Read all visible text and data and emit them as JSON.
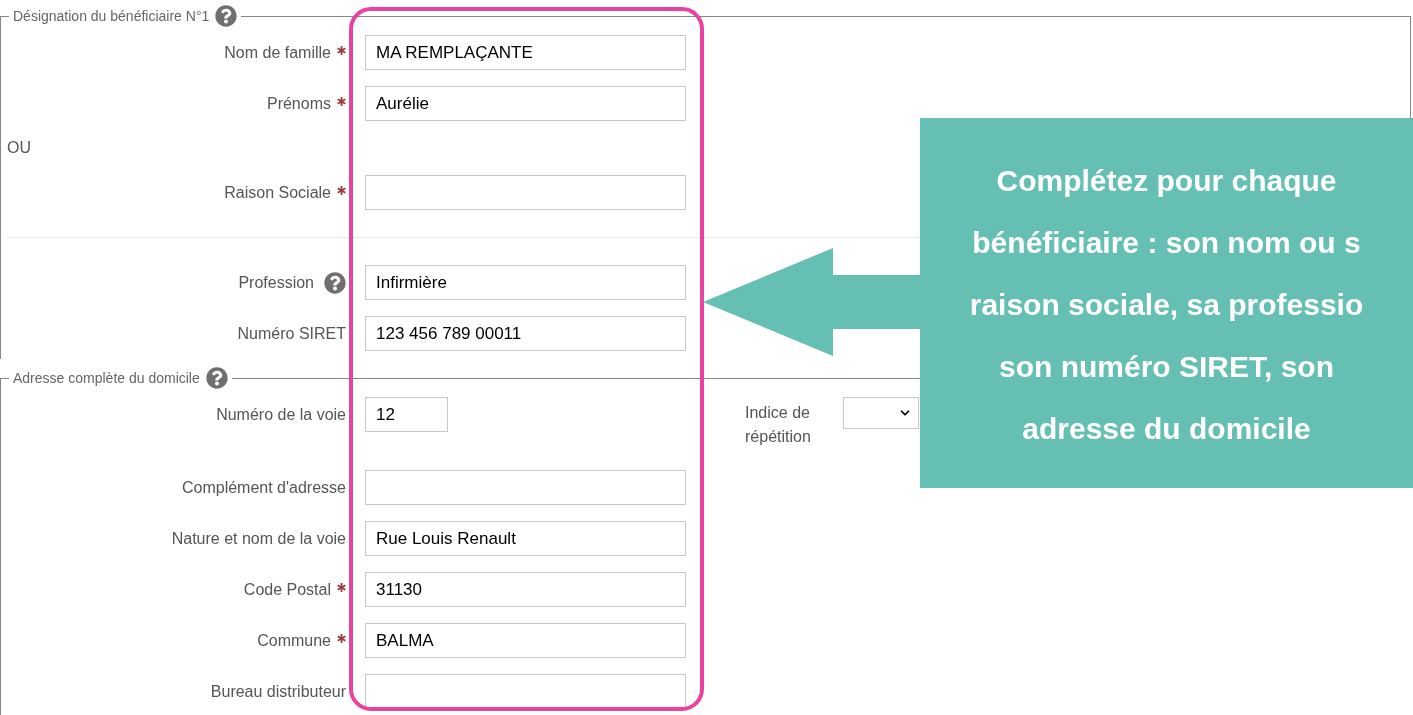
{
  "sections": [
    {
      "legend": "Désignation du bénéficiaire N°1",
      "help": true,
      "rows": [
        {
          "kind": "field",
          "label": "Nom de famille",
          "required": true,
          "value": "MA REMPLAÇANTE"
        },
        {
          "kind": "field",
          "label": "Prénoms",
          "required": true,
          "value": "Aurélie"
        },
        {
          "kind": "note",
          "text": "OU"
        },
        {
          "kind": "field",
          "label": "Raison Sociale",
          "required": true
        },
        {
          "kind": "divider"
        },
        {
          "kind": "field",
          "label": "Profession",
          "help": true,
          "value": "Infirmière"
        },
        {
          "kind": "field",
          "label": "Numéro SIRET",
          "value": "123 456 789 00011"
        }
      ]
    },
    {
      "legend": "Adresse complète du domicile",
      "help": true,
      "rows": [
        {
          "kind": "short-field",
          "label": "Numéro de la voie",
          "value": "12",
          "side": {
            "label": "Indice de répétition"
          }
        },
        {
          "kind": "field",
          "label": "Complément d'adresse"
        },
        {
          "kind": "field",
          "label": "Nature et nom de la voie",
          "value": "Rue Louis Renault"
        },
        {
          "kind": "field",
          "label": "Code Postal",
          "required": true,
          "value": "31130"
        },
        {
          "kind": "field",
          "label": "Commune",
          "required": true,
          "value": "BALMA"
        },
        {
          "kind": "field",
          "label": "Bureau distributeur"
        }
      ]
    }
  ],
  "annotation": {
    "lines": [
      "Complétez pour chaque",
      "bénéficiaire : son nom ou s",
      "raison sociale, sa professio",
      "son numéro SIRET, son",
      "adresse du domicile"
    ]
  }
}
